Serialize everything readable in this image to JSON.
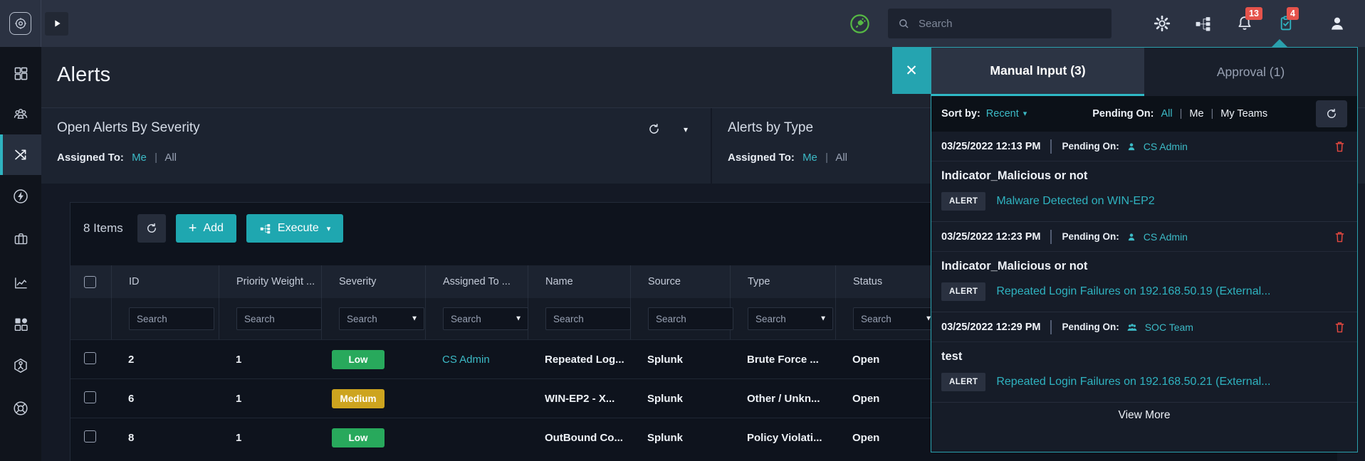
{
  "ui": {
    "pipe": "|"
  },
  "topbar": {
    "search_placeholder": "Search",
    "notifications_badge": "13",
    "tasks_badge": "4"
  },
  "page": {
    "title": "Alerts"
  },
  "widgets": {
    "severity": {
      "title": "Open Alerts By Severity",
      "assigned_label": "Assigned To:",
      "option_me": "Me",
      "option_all": "All"
    },
    "by_type": {
      "title": "Alerts by Type",
      "assigned_label": "Assigned To:",
      "option_me": "Me",
      "option_all": "All"
    }
  },
  "table": {
    "items_count": "8 Items",
    "add_label": "Add",
    "execute_label": "Execute",
    "search_placeholder": "Search",
    "columns": {
      "id": "ID",
      "priority": "Priority Weight ...",
      "severity": "Severity",
      "assigned": "Assigned To  ...",
      "name": "Name",
      "source": "Source",
      "type": "Type",
      "status": "Status"
    },
    "rows": [
      {
        "id": "2",
        "priority": "1",
        "severity": "Low",
        "assigned": "CS Admin",
        "name": "Repeated Log...",
        "source": "Splunk",
        "type": "Brute Force ...",
        "status": "Open"
      },
      {
        "id": "6",
        "priority": "1",
        "severity": "Medium",
        "assigned": "",
        "name": "WIN-EP2 - X...",
        "source": "Splunk",
        "type": "Other / Unkn...",
        "status": "Open"
      },
      {
        "id": "8",
        "priority": "1",
        "severity": "Low",
        "assigned": "",
        "name": "OutBound Co...",
        "source": "Splunk",
        "type": "Policy Violati...",
        "status": "Open"
      }
    ]
  },
  "panel": {
    "tab_manual": "Manual Input (3)",
    "tab_approval": "Approval (1)",
    "sort_label": "Sort by:",
    "sort_value": "Recent",
    "pending_on_label": "Pending On:",
    "filter_all": "All",
    "filter_me": "Me",
    "filter_my_teams": "My Teams",
    "cards": [
      {
        "timestamp": "03/25/2022 12:13 PM",
        "pending_label": "Pending On:",
        "assignee": "CS Admin",
        "title": "Indicator_Malicious or not",
        "badge": "ALERT",
        "link": "Malware Detected on WIN-EP2"
      },
      {
        "timestamp": "03/25/2022 12:23 PM",
        "pending_label": "Pending On:",
        "assignee": "CS Admin",
        "title": "Indicator_Malicious or not",
        "badge": "ALERT",
        "link": "Repeated Login Failures on 192.168.50.19 (External..."
      },
      {
        "timestamp": "03/25/2022 12:29 PM",
        "pending_label": "Pending On:",
        "assignee": "SOC Team",
        "title": "test",
        "badge": "ALERT",
        "link": "Repeated Login Failures on 192.168.50.21 (External..."
      }
    ],
    "view_more": "View More"
  },
  "colors": {
    "accent_teal": "#1fa7b0",
    "link_teal": "#2fb3c0",
    "severity_low": "#28a95c",
    "severity_medium": "#cda41f",
    "badge_red": "#e5534b",
    "plug_green": "#56b944"
  }
}
